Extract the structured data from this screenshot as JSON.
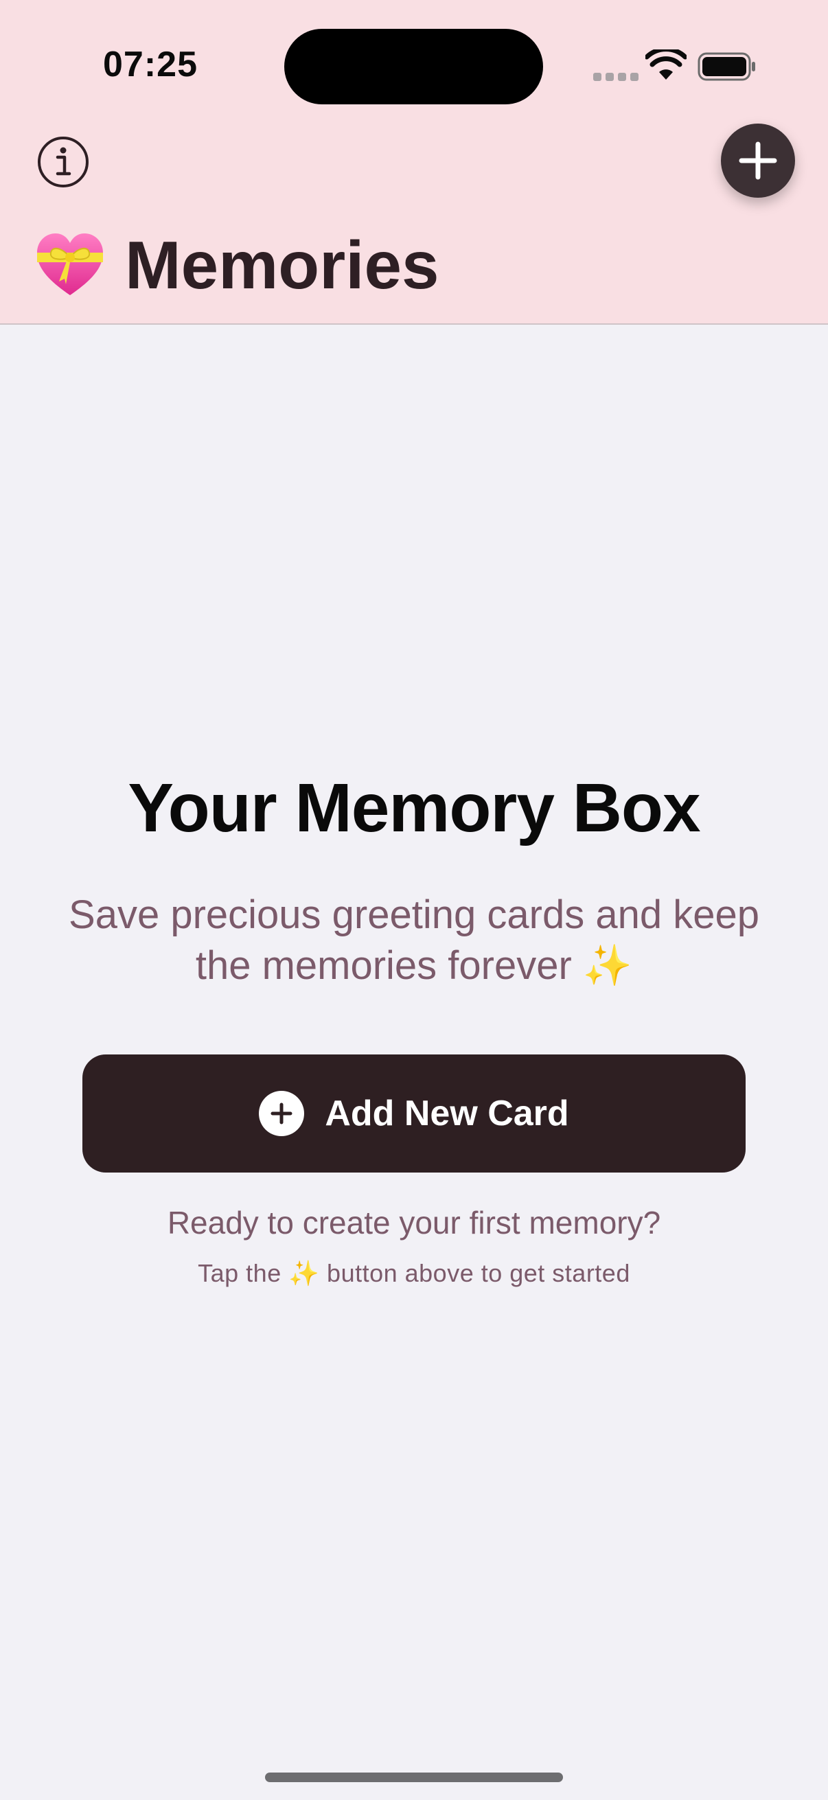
{
  "status_bar": {
    "time": "07:25"
  },
  "header": {
    "title": "Memories",
    "title_emoji": "heart-with-ribbon-icon",
    "info_icon": "info-icon",
    "add_icon": "plus-icon"
  },
  "empty_state": {
    "heading": "Your Memory Box",
    "subtitle": "Save precious greeting cards and keep the memories forever ✨",
    "button_label": "Add New Card",
    "ready_text": "Ready to create your first memory?",
    "hint_text": "Tap the ✨ button above to get started"
  },
  "colors": {
    "header_bg": "#f9dfe3",
    "page_bg": "#f2f1f6",
    "primary_dark": "#2e1f22",
    "muted_text": "#7b5a6a"
  }
}
